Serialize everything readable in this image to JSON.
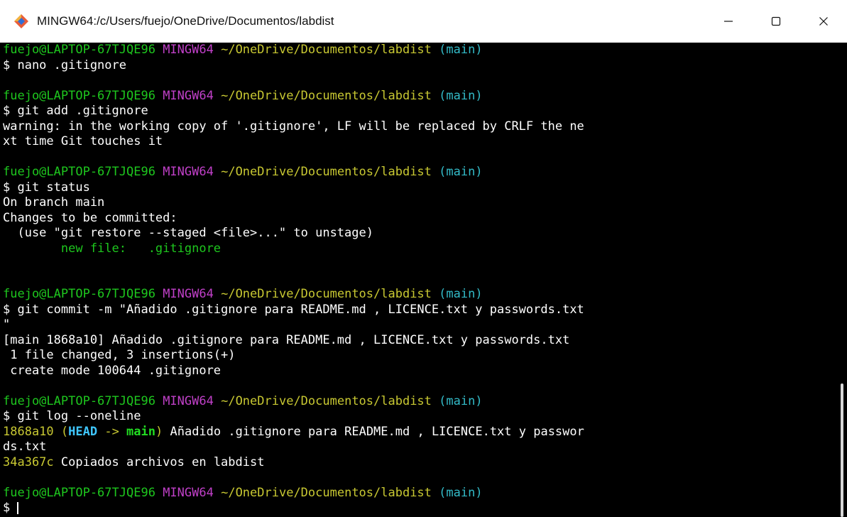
{
  "window": {
    "title": "MINGW64:/c/Users/fuejo/OneDrive/Documentos/labdist",
    "controls": {
      "minimize": "—",
      "maximize": "□",
      "close": "✕"
    }
  },
  "prompt": {
    "user_host": "fuejo@LAPTOP-67TJQE96",
    "shell": "MINGW64",
    "path": "~/OneDrive/Documentos/labdist",
    "branch": "(main)"
  },
  "blocks": [
    {
      "command": "$ nano .gitignore",
      "output": []
    },
    {
      "command": "$ git add .gitignore",
      "output": [
        "warning: in the working copy of '.gitignore', LF will be replaced by CRLF the ne",
        "xt time Git touches it"
      ]
    },
    {
      "command": "$ git status",
      "output": [
        "On branch main",
        "Changes to be committed:",
        "  (use \"git restore --staged <file>...\" to unstage)"
      ],
      "staged": "        new file:   .gitignore"
    },
    {
      "command": "$ git commit -m \"Añadido .gitignore para README.md , LICENCE.txt y passwords.txt",
      "command_cont": "\"",
      "output": [
        "[main 1868a10] Añadido .gitignore para README.md , LICENCE.txt y passwords.txt",
        " 1 file changed, 3 insertions(+)",
        " create mode 100644 .gitignore"
      ]
    },
    {
      "command": "$ git log --oneline",
      "log": [
        {
          "hash": "1868a10",
          "open": " (",
          "head": "HEAD",
          "arrow": " -> ",
          "branch": "main",
          "close": ")",
          "msg": " Añadido .gitignore para README.md , LICENCE.txt y passwor"
        },
        {
          "cont": "ds.txt"
        },
        {
          "hash": "34a367c",
          "msg": " Copiados archivos en labdist"
        }
      ]
    },
    {
      "command": "$ "
    }
  ],
  "colors": {
    "user_host": "#1ec71e",
    "shell": "#c040c8",
    "path": "#c8c832",
    "branch": "#33bbc8",
    "staged": "#1ec71e",
    "background": "#000000"
  },
  "icons": {
    "app": "git-bash-icon"
  }
}
